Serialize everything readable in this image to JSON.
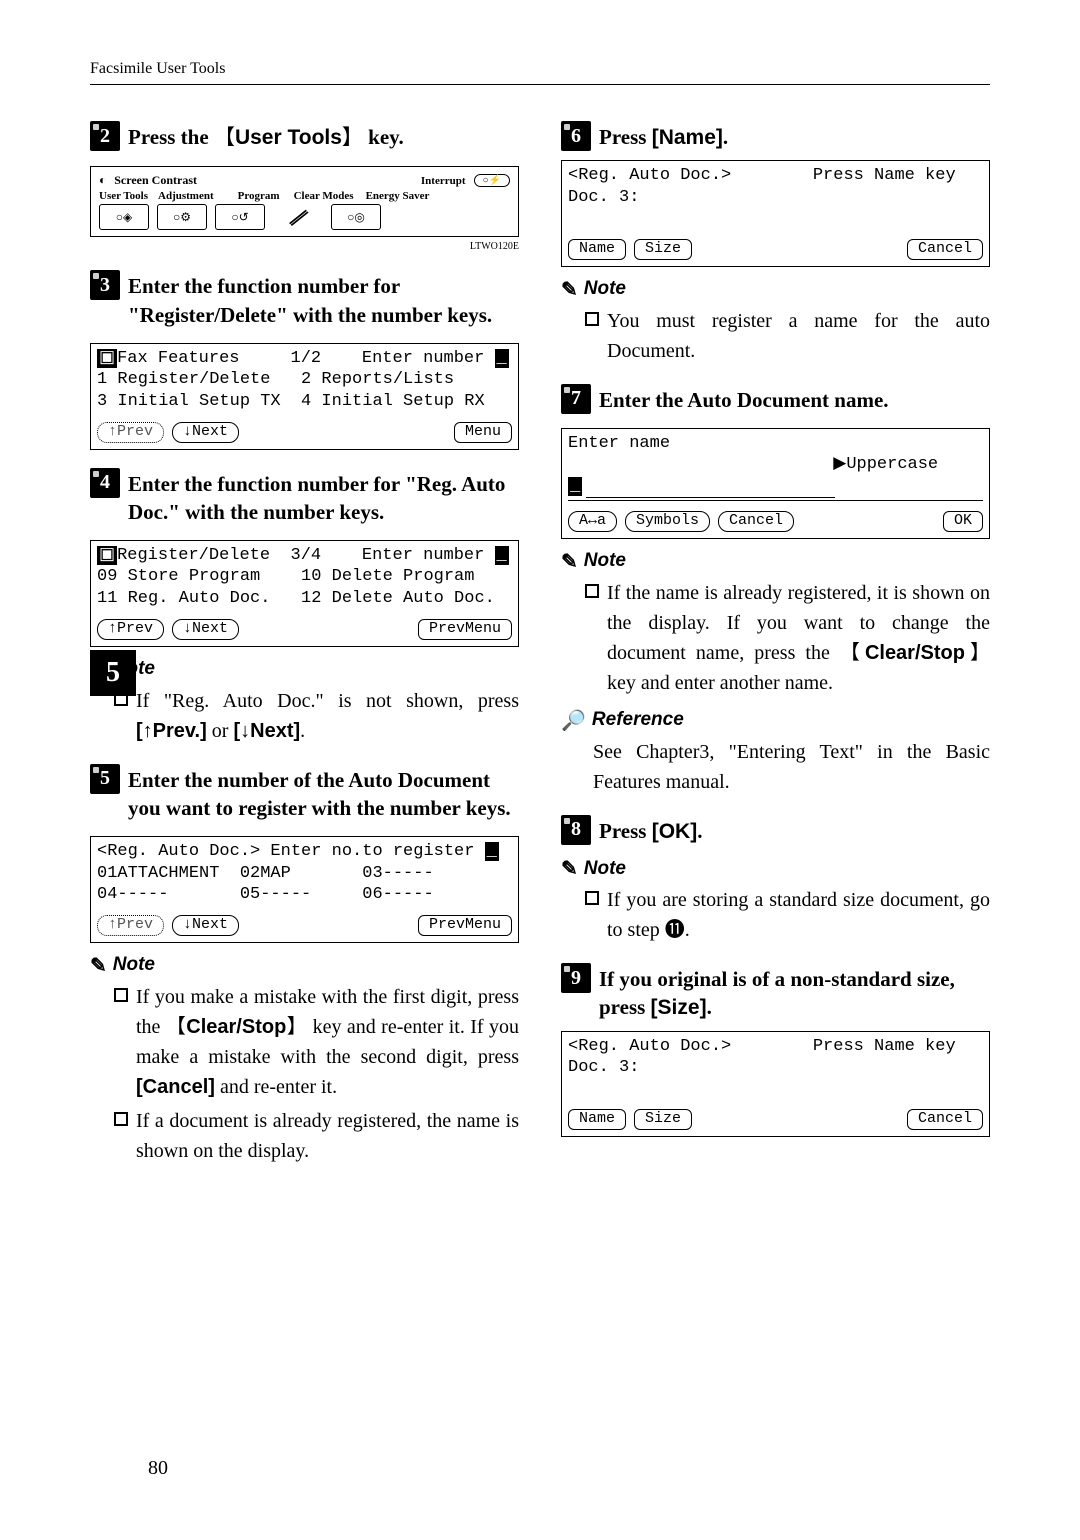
{
  "header": {
    "title": "Facsimile User Tools"
  },
  "sideTab": "5",
  "pageNumber": "80",
  "steps": {
    "s2": {
      "num": "2",
      "text_a": "Press the ",
      "key": "User Tools",
      "text_b": " key."
    },
    "s3": {
      "num": "3",
      "text": "Enter the function number for \"Register/Delete\" with the number keys."
    },
    "s4": {
      "num": "4",
      "text": "Enter the function number for \"Reg. Auto Doc.\" with the number keys."
    },
    "s5": {
      "num": "5",
      "text": "Enter the number of the Auto Document you want to register with the number keys."
    },
    "s6": {
      "num": "6",
      "text_a": "Press ",
      "key": "Name",
      "text_b": "."
    },
    "s7": {
      "num": "7",
      "text": "Enter the Auto Document name."
    },
    "s8": {
      "num": "8",
      "text_a": "Press ",
      "key": "OK",
      "text_b": "."
    },
    "s9": {
      "num": "9",
      "text_a": "If you original is of a non-standard size, press ",
      "key": "Size",
      "text_b": "."
    }
  },
  "panel2": {
    "contrastLabel": "Screen Contrast",
    "interrupt": "Interrupt",
    "row": [
      "User Tools",
      "Adjustment",
      "Program",
      "Clear Modes",
      "Energy Saver"
    ],
    "footer": "LTWO120E"
  },
  "lcd3": {
    "title": "Fax Features     1/2    Enter number",
    "l1": "1 Register/Delete   2 Reports/Lists",
    "l2": "3 Initial Setup TX  4 Initial Setup RX",
    "btnPrev": "↑Prev",
    "btnNext": "↓Next",
    "btnMenu": "Menu"
  },
  "lcd4": {
    "title": "Register/Delete  3/4    Enter number",
    "l1": "09 Store Program    10 Delete Program",
    "l2": "11 Reg. Auto Doc.   12 Delete Auto Doc.",
    "btnPrev": "↑Prev",
    "btnNext": "↓Next",
    "btnMenu": "PrevMenu"
  },
  "lcd5": {
    "title": "<Reg. Auto Doc.> Enter no.to register",
    "l1": "01ATTACHMENT  02MAP       03-----",
    "l2": "04-----       05-----     06-----",
    "btnPrev": "↑Prev",
    "btnNext": "↓Next",
    "btnMenu": "PrevMenu"
  },
  "lcd6": {
    "l1": "<Reg. Auto Doc.>        Press Name key",
    "l2": "Doc. 3:",
    "btnName": "Name",
    "btnSize": "Size",
    "btnCancel": "Cancel"
  },
  "lcd7": {
    "l1": "Enter name",
    "l2": "                          ▶Uppercase",
    "cursor": "_",
    "btnA": "A↔a",
    "btnSym": "Symbols",
    "btnCancel": "Cancel",
    "btnOK": "OK"
  },
  "lcd9": {
    "l1": "<Reg. Auto Doc.>        Press Name key",
    "l2": "Doc. 3:",
    "btnName": "Name",
    "btnSize": "Size",
    "btnCancel": "Cancel"
  },
  "notes": {
    "heading": "Note",
    "n4": {
      "text_a": "If \"Reg. Auto Doc.\" is not shown, press ",
      "k1": "↑Prev.",
      "mid": " or ",
      "k2": "↓Next",
      "tail": "."
    },
    "n5a": {
      "text_a": "If you make a mistake with the first digit, press the ",
      "k1": "Clear/Stop",
      "mid": " key and re-enter it. If you make a mistake with the second digit, press ",
      "k2": "Cancel",
      "tail": " and re-enter it."
    },
    "n5b": "If a document is already registered, the name is shown on the display.",
    "n6": "You must register a name for the auto Document.",
    "n7": {
      "text_a": "If the name is already registered, it is shown on the display. If you want to change the document name, press the ",
      "k1": "Clear/Stop",
      "tail": " key and enter another name."
    },
    "n8": "If you are storing a standard size document, go to step ⓫."
  },
  "reference": {
    "heading": "Reference",
    "text": "See Chapter3, \"Entering Text\" in the Basic Features manual."
  }
}
